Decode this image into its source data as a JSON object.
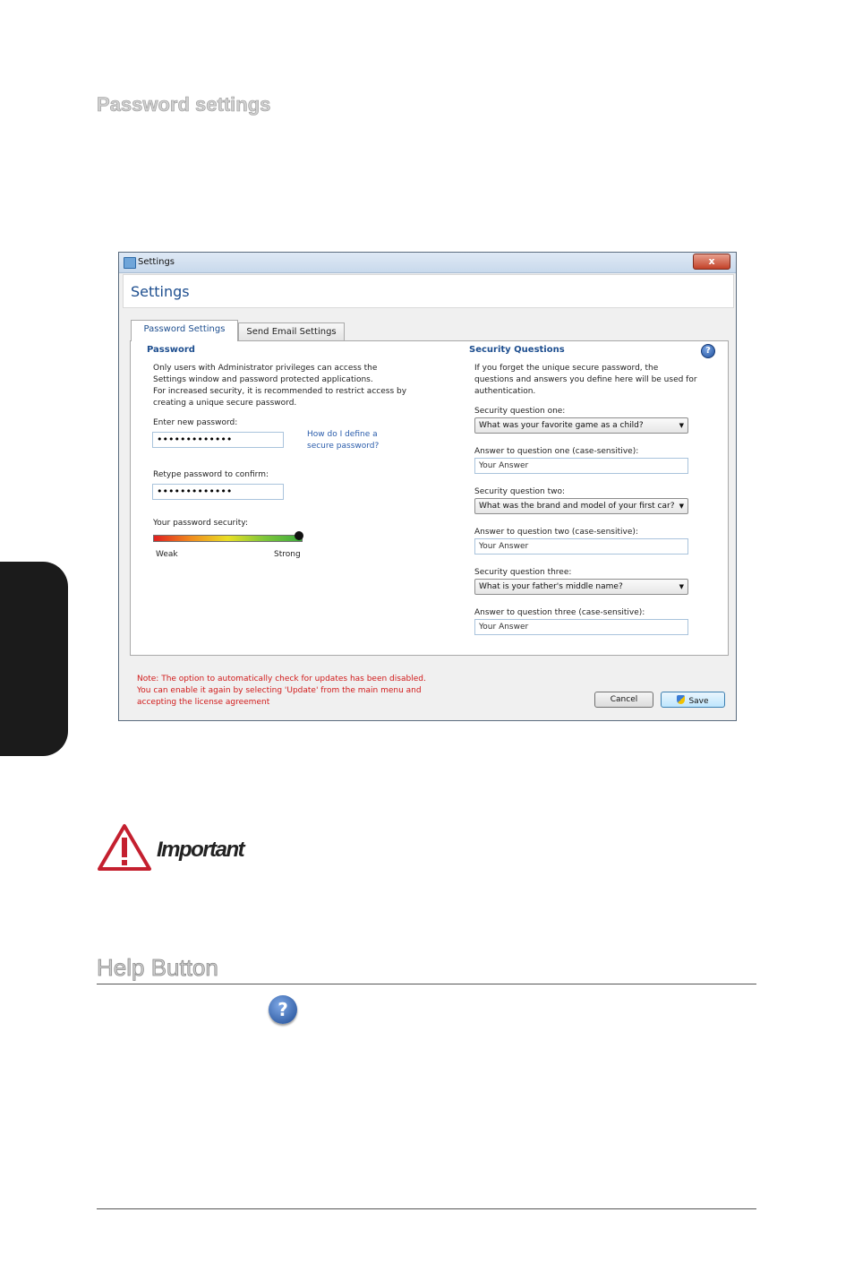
{
  "document": {
    "section1_title": "Password settings",
    "important_label": "Important",
    "section2_title": "Help Button",
    "help_icon_glyph": "?"
  },
  "window": {
    "title": "Settings",
    "close_glyph": "x",
    "heading": "Settings",
    "tabs": [
      {
        "label": "Password Settings",
        "active": true
      },
      {
        "label": "Send Email Settings",
        "active": false
      }
    ],
    "password": {
      "header": "Password",
      "description": "Only users with Administrator privileges can access the Settings window and password protected applications.\nFor increased security, it is recommended to restrict access by creating a unique secure password.",
      "new_password_label": "Enter new password:",
      "new_password_value": "•••••••••••••",
      "help_link": "How do I define a\nsecure password?",
      "retype_label": "Retype password to confirm:",
      "retype_value": "•••••••••••••",
      "security_label": "Your password security:",
      "weak_label": "Weak",
      "strong_label": "Strong"
    },
    "security_questions": {
      "header": "Security Questions",
      "help_glyph": "?",
      "description": "If you forget the unique secure password, the questions and answers you define here will be used for authentication.",
      "q1_label": "Security question one:",
      "q1_value": "What was your favorite game as a child?",
      "a1_label": "Answer to question one (case-sensitive):",
      "a1_value": "Your Answer",
      "q2_label": "Security question two:",
      "q2_value": "What was the brand and model of your first car?",
      "a2_label": "Answer to question two (case-sensitive):",
      "a2_value": "Your Answer",
      "q3_label": "Security question three:",
      "q3_value": "What is your father's middle name?",
      "a3_label": "Answer to question three (case-sensitive):",
      "a3_value": "Your Answer"
    },
    "note": "Note: The option to automatically check for updates has been disabled.\nYou can enable it again by selecting 'Update' from the main menu and\naccepting the license agreement",
    "cancel_label": "Cancel",
    "save_label": "Save",
    "accent_color": "#1d4e8f",
    "note_color": "#d11b1b"
  }
}
